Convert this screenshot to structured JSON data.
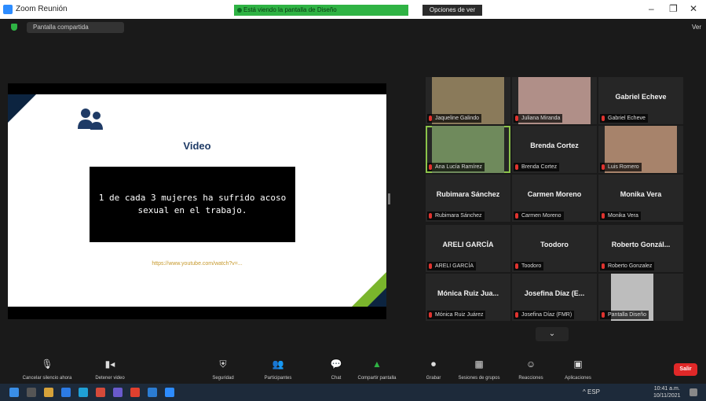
{
  "window": {
    "title": "Zoom Reunión",
    "share_banner": "Está viendo la pantalla de Diseño",
    "stop_button": "Opciones de ver",
    "controls": [
      "–",
      "❐",
      "✕"
    ]
  },
  "meeting": {
    "screen_label": "Pantalla compartida",
    "view_label": "Ver"
  },
  "slide": {
    "title": "Video",
    "text": "1 de cada 3 mujeres ha sufrido acoso sexual en el trabajo.",
    "link": "https://www.youtube.com/watch?v=...",
    "accent_navy": "#0c2440",
    "accent_green": "#7ab52c"
  },
  "gallery": {
    "tiles": [
      {
        "name": "",
        "label": "Jaqueline Galindo",
        "video": true
      },
      {
        "name": "",
        "label": "Juliana Miranda",
        "video": true
      },
      {
        "name": "Gabriel Echeve",
        "label": "Gabriel Echeve",
        "video": false
      },
      {
        "name": "",
        "label": "Ana Lucía Ramírez",
        "video": true
      },
      {
        "name": "Brenda Cortez",
        "label": "Brenda Cortez",
        "video": false
      },
      {
        "name": "",
        "label": "Luis Romero",
        "video": true
      },
      {
        "name": "Rubimara Sánchez",
        "label": "Rubimara Sánchez",
        "video": false
      },
      {
        "name": "Carmen Moreno",
        "label": "Carmen Moreno",
        "video": false
      },
      {
        "name": "Monika Vera",
        "label": "Monika Vera",
        "video": false
      },
      {
        "name": "ARELI GARCÍA",
        "label": "ARELI GARCÍA",
        "video": false
      },
      {
        "name": "Toodoro",
        "label": "Toodoro",
        "video": false
      },
      {
        "name": "Roberto Gonzál...",
        "label": "Roberto Gonzalez",
        "video": false
      },
      {
        "name": "Mónica Ruiz Jua...",
        "label": "Mónica Ruiz Juárez",
        "video": false
      },
      {
        "name": "Josefina Díaz (E...",
        "label": "Josefina Díaz (FMR)",
        "video": false
      },
      {
        "name": "",
        "label": "Pantalla Diseño",
        "video": true
      }
    ],
    "next_page": "⌄"
  },
  "toolbar": {
    "items": [
      {
        "label": "Cancelar silencio ahora",
        "icon": "microphone-icon"
      },
      {
        "label": "Detener video",
        "icon": "video-camera-icon"
      },
      {
        "label": "Seguridad",
        "icon": "shield-icon"
      },
      {
        "label": "Participantes",
        "icon": "participants-icon"
      },
      {
        "label": "Chat",
        "icon": "chat-icon"
      },
      {
        "label": "Compartir pantalla",
        "icon": "share-screen-icon"
      },
      {
        "label": "Grabar",
        "icon": "record-icon"
      },
      {
        "label": "Sesiones de grupos",
        "icon": "breakout-icon"
      },
      {
        "label": "Reacciones",
        "icon": "reactions-icon"
      },
      {
        "label": "Aplicaciones",
        "icon": "apps-icon"
      }
    ],
    "end_label": "Salir"
  },
  "taskbar": {
    "tray_text": "^ ESP",
    "time": "10:41 a.m.",
    "date": "10/11/2021"
  }
}
